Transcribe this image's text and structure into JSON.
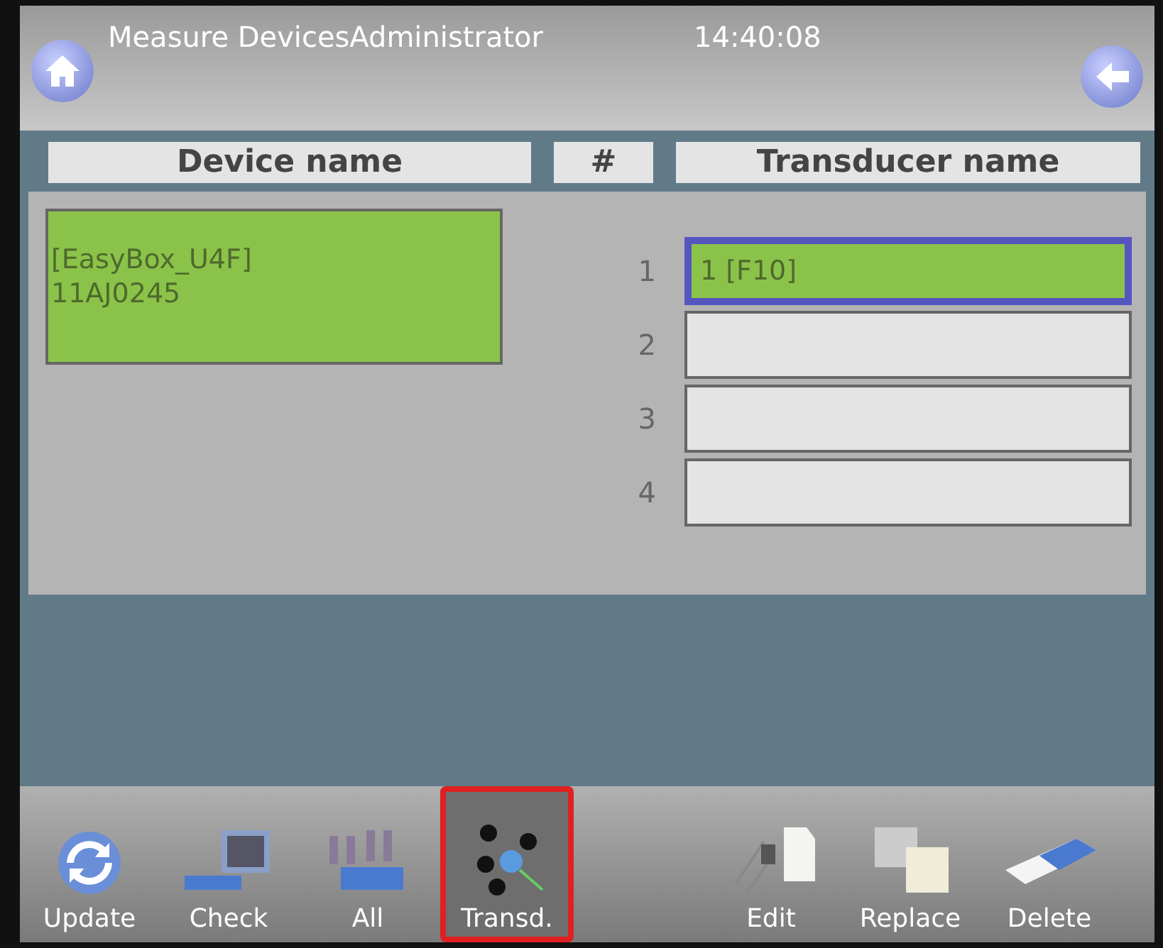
{
  "header": {
    "title": "Measure DevicesAdministrator",
    "time": "14:40:08"
  },
  "columns": [
    "Device name",
    "#",
    "Transducer name"
  ],
  "devices": [
    {
      "name": "[EasyBox_U4F]",
      "serial": "11AJ0245",
      "selected": true
    }
  ],
  "transducers": [
    {
      "number": "1",
      "name": "1 [F10]",
      "selected": true
    },
    {
      "number": "2",
      "selected": false
    },
    {
      "number": "3",
      "selected": false
    },
    {
      "number": "4",
      "selected": false
    }
  ],
  "toolbar": [
    {
      "kind": "update",
      "label": "Update",
      "selected": false
    },
    {
      "kind": "check",
      "label": "Check",
      "selected": false
    },
    {
      "kind": "all",
      "label": "All",
      "selected": false
    },
    {
      "kind": "transducer",
      "label": "Transd.",
      "selected": true
    },
    {
      "kind": "spacer"
    },
    {
      "kind": "edit",
      "label": "Edit",
      "selected": false
    },
    {
      "kind": "replace",
      "label": "Replace",
      "selected": false
    },
    {
      "kind": "delete",
      "label": "Delete",
      "selected": false
    }
  ]
}
